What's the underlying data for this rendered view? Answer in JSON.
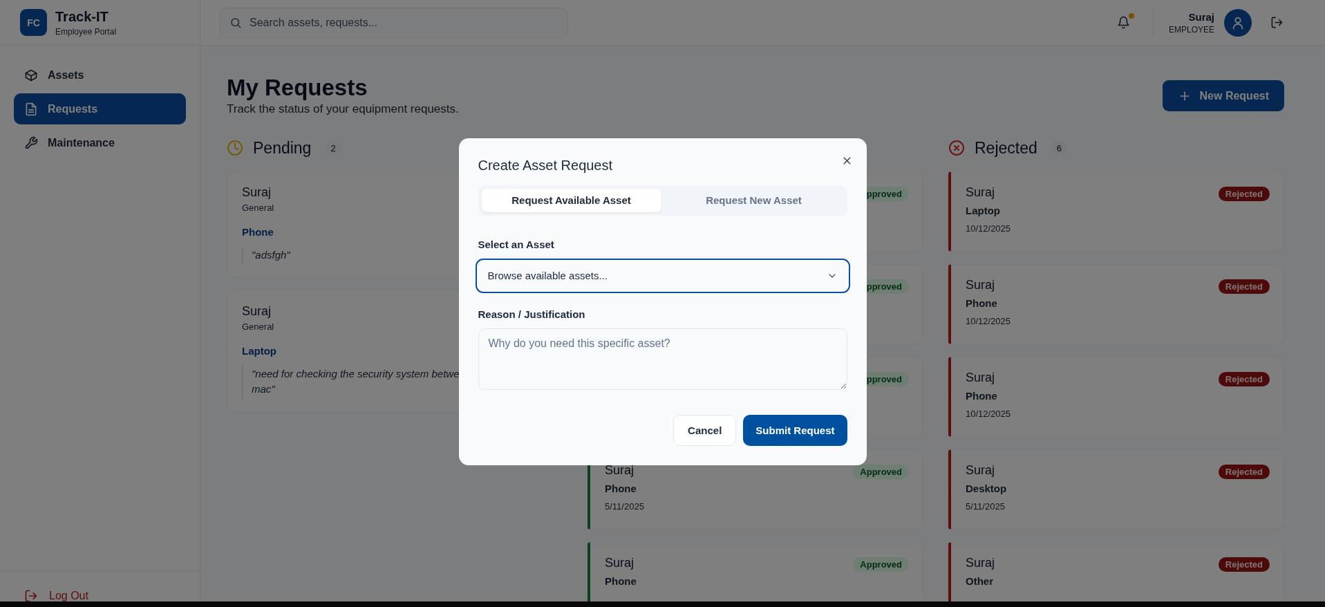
{
  "app": {
    "logo": "FC",
    "name": "Track-IT",
    "subtitle": "Employee Portal"
  },
  "sidebar": {
    "items": [
      {
        "label": "Assets",
        "selected": false
      },
      {
        "label": "Requests",
        "selected": true
      },
      {
        "label": "Maintenance",
        "selected": false
      }
    ],
    "logout": "Log Out"
  },
  "header": {
    "search": {
      "placeholder": "Search assets, requests..."
    },
    "notifications": {
      "unread": true
    },
    "user": {
      "name": "Suraj",
      "role": "EMPLOYEE"
    }
  },
  "page": {
    "title": "My Requests",
    "subtitle": "Track the status of your equipment requests.",
    "new_button": "New Request"
  },
  "columns": [
    {
      "kind": "pending",
      "title": "Pending",
      "count": "2",
      "cards": [
        {
          "name": "Suraj",
          "department": "General",
          "asset": "Phone",
          "note_lines": [
            "\"adsfgh\""
          ]
        },
        {
          "name": "Suraj",
          "department": "General",
          "asset": "Laptop",
          "note_lines": [
            "\"need for checking the security system betwe",
            "mac\""
          ]
        }
      ]
    },
    {
      "kind": "approved",
      "cards": [
        {
          "badge": "pproved"
        },
        {
          "badge": "pproved"
        },
        {
          "badge": "pproved"
        },
        {
          "name": "Suraj",
          "asset": "Phone",
          "date": "5/11/2025",
          "badge": "Approved"
        },
        {
          "name": "Suraj",
          "asset": "Phone",
          "badge": "Approved"
        }
      ]
    },
    {
      "kind": "rejected",
      "title": "Rejected",
      "count": "6",
      "cards": [
        {
          "name": "Suraj",
          "asset": "Laptop",
          "date": "10/12/2025",
          "badge": "Rejected"
        },
        {
          "name": "Suraj",
          "asset": "Phone",
          "date": "10/12/2025",
          "badge": "Rejected"
        },
        {
          "name": "Suraj",
          "asset": "Phone",
          "date": "10/12/2025",
          "badge": "Rejected"
        },
        {
          "name": "Suraj",
          "asset": "Desktop",
          "date": "5/11/2025",
          "badge": "Rejected"
        },
        {
          "name": "Suraj",
          "asset": "Other",
          "badge": "Rejected"
        }
      ]
    }
  ],
  "dialog": {
    "title": "Create Asset Request",
    "tabs": [
      {
        "label": "Request Available Asset",
        "selected": true
      },
      {
        "label": "Request New Asset",
        "selected": false
      }
    ],
    "select": {
      "label": "Select an Asset",
      "value": "Browse available assets...",
      "focused": true
    },
    "reason": {
      "label": "Reason / Justification",
      "placeholder": "Why do you need this specific asset?"
    },
    "buttons": [
      {
        "kind": "secondary",
        "label": "Cancel"
      },
      {
        "kind": "primary",
        "label": "Submit Request"
      }
    ]
  }
}
